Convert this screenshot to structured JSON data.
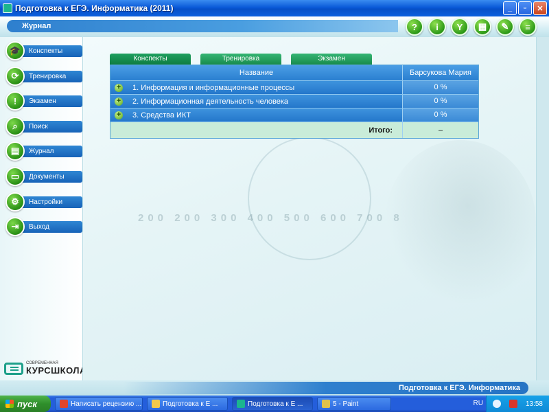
{
  "window": {
    "title": "Подготовка к ЕГЭ. Информатика (2011)",
    "buttons": {
      "minimize": "_",
      "maximize": "▫",
      "close": "✕"
    }
  },
  "header": {
    "section_title": "Журнал",
    "toolbar": [
      {
        "name": "help",
        "glyph": "?"
      },
      {
        "name": "info",
        "glyph": "i"
      },
      {
        "name": "filter",
        "glyph": "Y"
      },
      {
        "name": "notes",
        "glyph": "▦"
      },
      {
        "name": "edit",
        "glyph": "✎"
      },
      {
        "name": "menu",
        "glyph": "≡"
      }
    ]
  },
  "sidebar": {
    "items": [
      {
        "label": "Конспекты",
        "glyph": "🎓"
      },
      {
        "label": "Тренировка",
        "glyph": "⟳"
      },
      {
        "label": "Экзамен",
        "glyph": "!"
      },
      {
        "label": "Поиск",
        "glyph": "⌕"
      },
      {
        "label": "Журнал",
        "glyph": "▤"
      },
      {
        "label": "Документы",
        "glyph": "▭"
      },
      {
        "label": "Настройки",
        "glyph": "⚙"
      },
      {
        "label": "Выход",
        "glyph": "⇥"
      }
    ],
    "logo": {
      "small": "СОВРЕМЕННАЯ",
      "main": "КУРСШКОЛА"
    }
  },
  "tabs": [
    {
      "label": "Конспекты",
      "active": true
    },
    {
      "label": "Тренировка",
      "active": false
    },
    {
      "label": "Экзамен",
      "active": false
    }
  ],
  "grid": {
    "headers": [
      "Название",
      "Барсукова Мария"
    ],
    "rows": [
      {
        "title": "1. Информация и информационные процессы",
        "value": "0 %"
      },
      {
        "title": "2. Информационная деятельность человека",
        "value": "0 %"
      },
      {
        "title": "3. Средства ИКТ",
        "value": "0 %"
      }
    ],
    "total_label": "Итого:",
    "total_value": "–"
  },
  "background_numbers": "200 200 300 400   500   600 700 8",
  "footer": {
    "title": "Подготовка к ЕГЭ. Информатика"
  },
  "taskbar": {
    "start": "пуск",
    "tasks": [
      {
        "label": "Написать рецензию ...",
        "color": "#e0452b"
      },
      {
        "label": "Подготовка к Е ...",
        "color": "#f3c94a"
      },
      {
        "label": "Подготовка к Е ...",
        "color": "#1bb58f"
      },
      {
        "label": "5 - Paint",
        "color": "#e0c24a"
      }
    ],
    "lang": "RU",
    "clock": "13:58"
  }
}
